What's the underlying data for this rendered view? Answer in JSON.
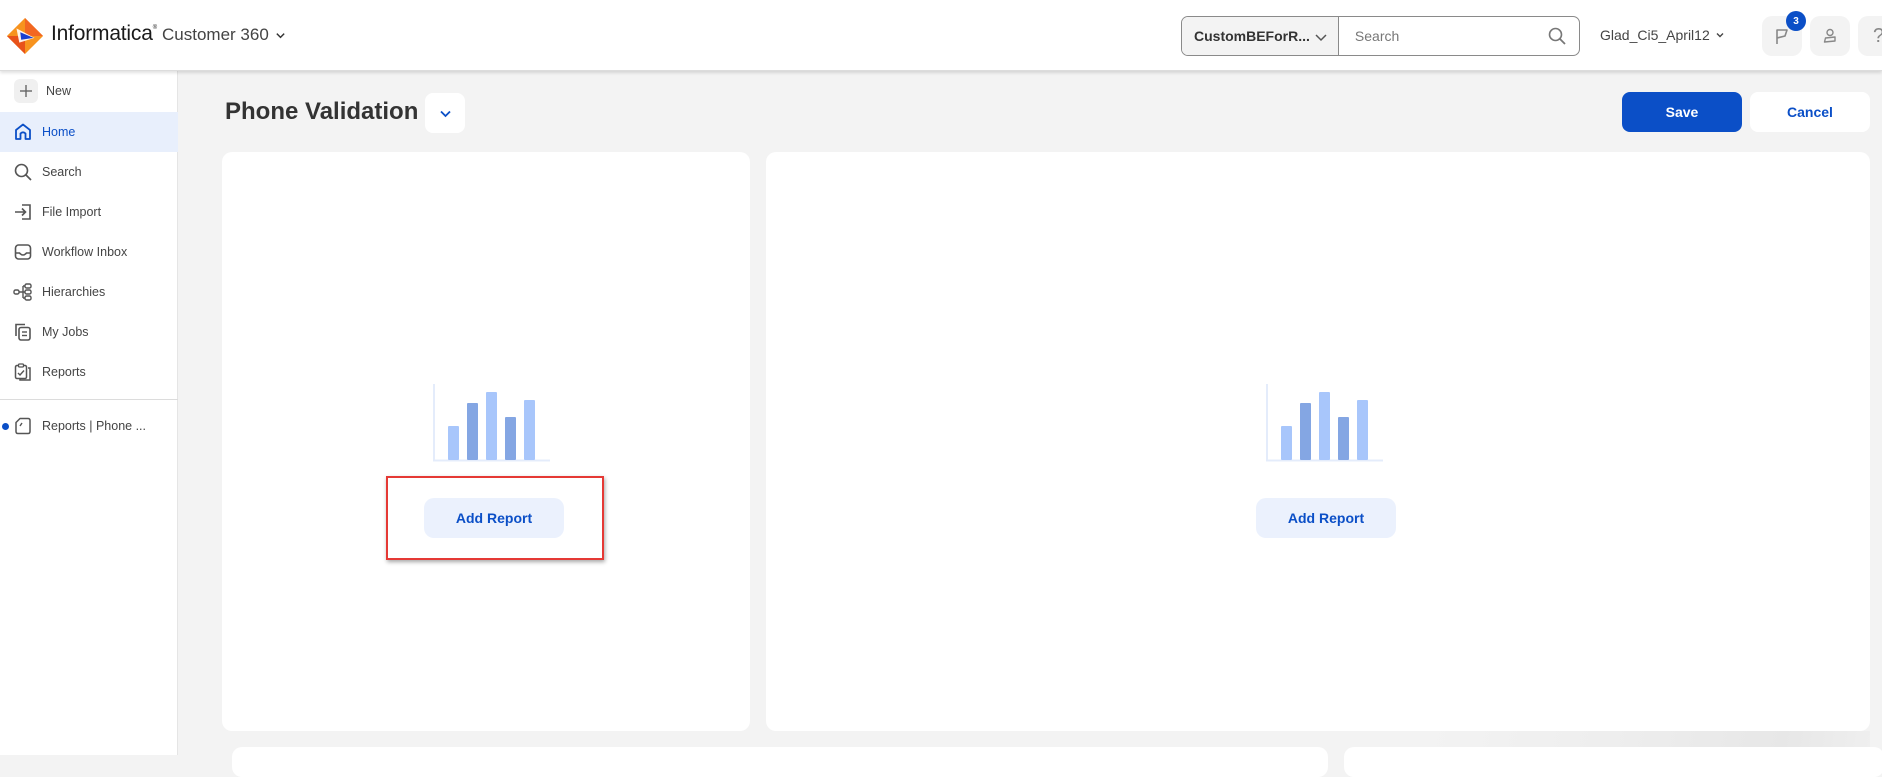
{
  "header": {
    "brand": "Informatica",
    "brand_mark": "®",
    "product": "Customer 360",
    "entity_select": "CustomBEForR...",
    "search_placeholder": "Search",
    "search_value": "",
    "org_name": "Glad_Ci5_April12",
    "notification_count": "3",
    "help_label": "?",
    "colors": {
      "accent": "#0b4fc7",
      "logo_orange": "#f26722"
    }
  },
  "sidebar": {
    "new_label": "New",
    "items": [
      {
        "label": "Home",
        "icon": "home-icon",
        "active": true
      },
      {
        "label": "Search",
        "icon": "search-icon",
        "active": false
      },
      {
        "label": "File Import",
        "icon": "file-import-icon",
        "active": false
      },
      {
        "label": "Workflow Inbox",
        "icon": "inbox-icon",
        "active": false
      },
      {
        "label": "Hierarchies",
        "icon": "hierarchy-icon",
        "active": false
      },
      {
        "label": "My Jobs",
        "icon": "jobs-icon",
        "active": false
      },
      {
        "label": "Reports",
        "icon": "reports-icon",
        "active": false
      }
    ],
    "open_tabs": [
      {
        "label": "Reports | Phone ...",
        "icon": "report-page-icon",
        "unsaved": true
      }
    ]
  },
  "main": {
    "title": "Phone Validation",
    "save_label": "Save",
    "cancel_label": "Cancel",
    "panels": [
      {
        "add_report_label": "Add Report",
        "highlighted": true
      },
      {
        "add_report_label": "Add Report",
        "highlighted": false
      }
    ]
  }
}
